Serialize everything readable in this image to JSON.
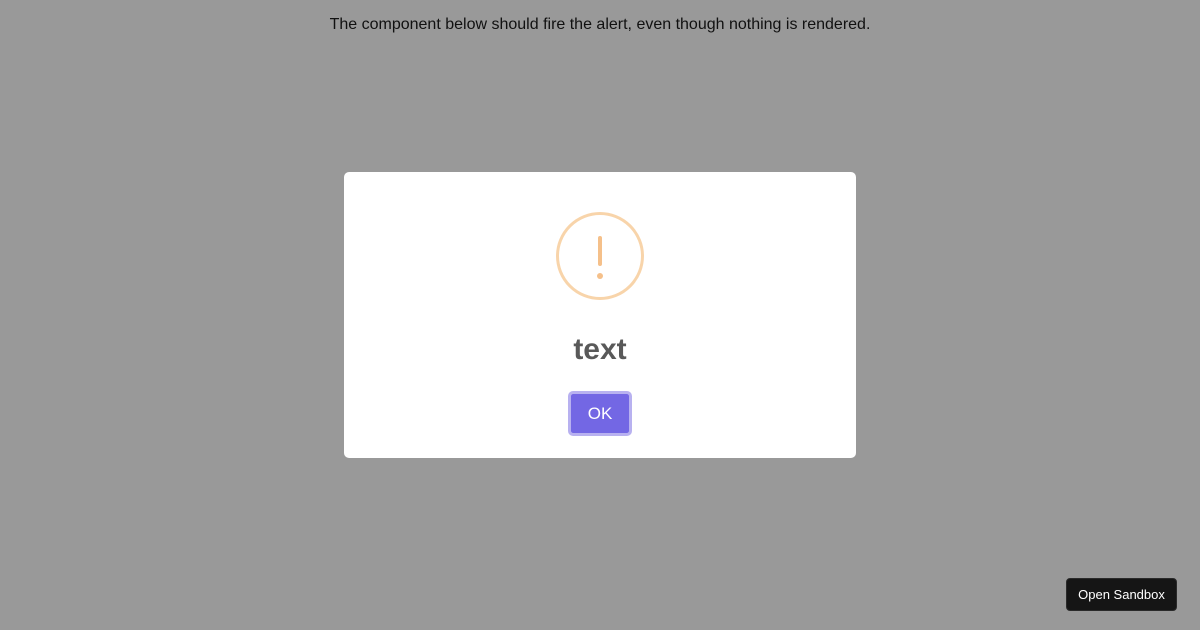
{
  "page": {
    "intro_text": "The component below should fire the alert, even though nothing is rendered."
  },
  "alert": {
    "icon": "warning-exclamation-icon",
    "icon_color": "#f8bb86",
    "title": "text",
    "confirm_label": "OK",
    "confirm_color": "#7367f0"
  },
  "sandbox": {
    "button_label": "Open Sandbox"
  }
}
